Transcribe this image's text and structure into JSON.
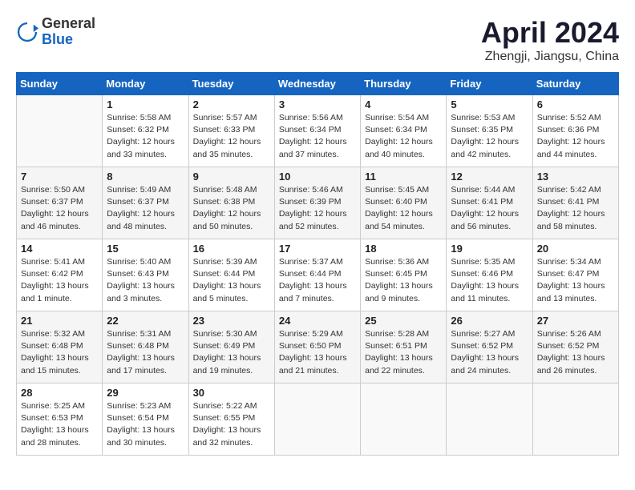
{
  "header": {
    "logo_general": "General",
    "logo_blue": "Blue",
    "title": "April 2024",
    "subtitle": "Zhengji, Jiangsu, China"
  },
  "calendar": {
    "days_of_week": [
      "Sunday",
      "Monday",
      "Tuesday",
      "Wednesday",
      "Thursday",
      "Friday",
      "Saturday"
    ],
    "weeks": [
      [
        {
          "day": "",
          "info": ""
        },
        {
          "day": "1",
          "info": "Sunrise: 5:58 AM\nSunset: 6:32 PM\nDaylight: 12 hours\nand 33 minutes."
        },
        {
          "day": "2",
          "info": "Sunrise: 5:57 AM\nSunset: 6:33 PM\nDaylight: 12 hours\nand 35 minutes."
        },
        {
          "day": "3",
          "info": "Sunrise: 5:56 AM\nSunset: 6:34 PM\nDaylight: 12 hours\nand 37 minutes."
        },
        {
          "day": "4",
          "info": "Sunrise: 5:54 AM\nSunset: 6:34 PM\nDaylight: 12 hours\nand 40 minutes."
        },
        {
          "day": "5",
          "info": "Sunrise: 5:53 AM\nSunset: 6:35 PM\nDaylight: 12 hours\nand 42 minutes."
        },
        {
          "day": "6",
          "info": "Sunrise: 5:52 AM\nSunset: 6:36 PM\nDaylight: 12 hours\nand 44 minutes."
        }
      ],
      [
        {
          "day": "7",
          "info": "Sunrise: 5:50 AM\nSunset: 6:37 PM\nDaylight: 12 hours\nand 46 minutes."
        },
        {
          "day": "8",
          "info": "Sunrise: 5:49 AM\nSunset: 6:37 PM\nDaylight: 12 hours\nand 48 minutes."
        },
        {
          "day": "9",
          "info": "Sunrise: 5:48 AM\nSunset: 6:38 PM\nDaylight: 12 hours\nand 50 minutes."
        },
        {
          "day": "10",
          "info": "Sunrise: 5:46 AM\nSunset: 6:39 PM\nDaylight: 12 hours\nand 52 minutes."
        },
        {
          "day": "11",
          "info": "Sunrise: 5:45 AM\nSunset: 6:40 PM\nDaylight: 12 hours\nand 54 minutes."
        },
        {
          "day": "12",
          "info": "Sunrise: 5:44 AM\nSunset: 6:41 PM\nDaylight: 12 hours\nand 56 minutes."
        },
        {
          "day": "13",
          "info": "Sunrise: 5:42 AM\nSunset: 6:41 PM\nDaylight: 12 hours\nand 58 minutes."
        }
      ],
      [
        {
          "day": "14",
          "info": "Sunrise: 5:41 AM\nSunset: 6:42 PM\nDaylight: 13 hours\nand 1 minute."
        },
        {
          "day": "15",
          "info": "Sunrise: 5:40 AM\nSunset: 6:43 PM\nDaylight: 13 hours\nand 3 minutes."
        },
        {
          "day": "16",
          "info": "Sunrise: 5:39 AM\nSunset: 6:44 PM\nDaylight: 13 hours\nand 5 minutes."
        },
        {
          "day": "17",
          "info": "Sunrise: 5:37 AM\nSunset: 6:44 PM\nDaylight: 13 hours\nand 7 minutes."
        },
        {
          "day": "18",
          "info": "Sunrise: 5:36 AM\nSunset: 6:45 PM\nDaylight: 13 hours\nand 9 minutes."
        },
        {
          "day": "19",
          "info": "Sunrise: 5:35 AM\nSunset: 6:46 PM\nDaylight: 13 hours\nand 11 minutes."
        },
        {
          "day": "20",
          "info": "Sunrise: 5:34 AM\nSunset: 6:47 PM\nDaylight: 13 hours\nand 13 minutes."
        }
      ],
      [
        {
          "day": "21",
          "info": "Sunrise: 5:32 AM\nSunset: 6:48 PM\nDaylight: 13 hours\nand 15 minutes."
        },
        {
          "day": "22",
          "info": "Sunrise: 5:31 AM\nSunset: 6:48 PM\nDaylight: 13 hours\nand 17 minutes."
        },
        {
          "day": "23",
          "info": "Sunrise: 5:30 AM\nSunset: 6:49 PM\nDaylight: 13 hours\nand 19 minutes."
        },
        {
          "day": "24",
          "info": "Sunrise: 5:29 AM\nSunset: 6:50 PM\nDaylight: 13 hours\nand 21 minutes."
        },
        {
          "day": "25",
          "info": "Sunrise: 5:28 AM\nSunset: 6:51 PM\nDaylight: 13 hours\nand 22 minutes."
        },
        {
          "day": "26",
          "info": "Sunrise: 5:27 AM\nSunset: 6:52 PM\nDaylight: 13 hours\nand 24 minutes."
        },
        {
          "day": "27",
          "info": "Sunrise: 5:26 AM\nSunset: 6:52 PM\nDaylight: 13 hours\nand 26 minutes."
        }
      ],
      [
        {
          "day": "28",
          "info": "Sunrise: 5:25 AM\nSunset: 6:53 PM\nDaylight: 13 hours\nand 28 minutes."
        },
        {
          "day": "29",
          "info": "Sunrise: 5:23 AM\nSunset: 6:54 PM\nDaylight: 13 hours\nand 30 minutes."
        },
        {
          "day": "30",
          "info": "Sunrise: 5:22 AM\nSunset: 6:55 PM\nDaylight: 13 hours\nand 32 minutes."
        },
        {
          "day": "",
          "info": ""
        },
        {
          "day": "",
          "info": ""
        },
        {
          "day": "",
          "info": ""
        },
        {
          "day": "",
          "info": ""
        }
      ]
    ]
  }
}
